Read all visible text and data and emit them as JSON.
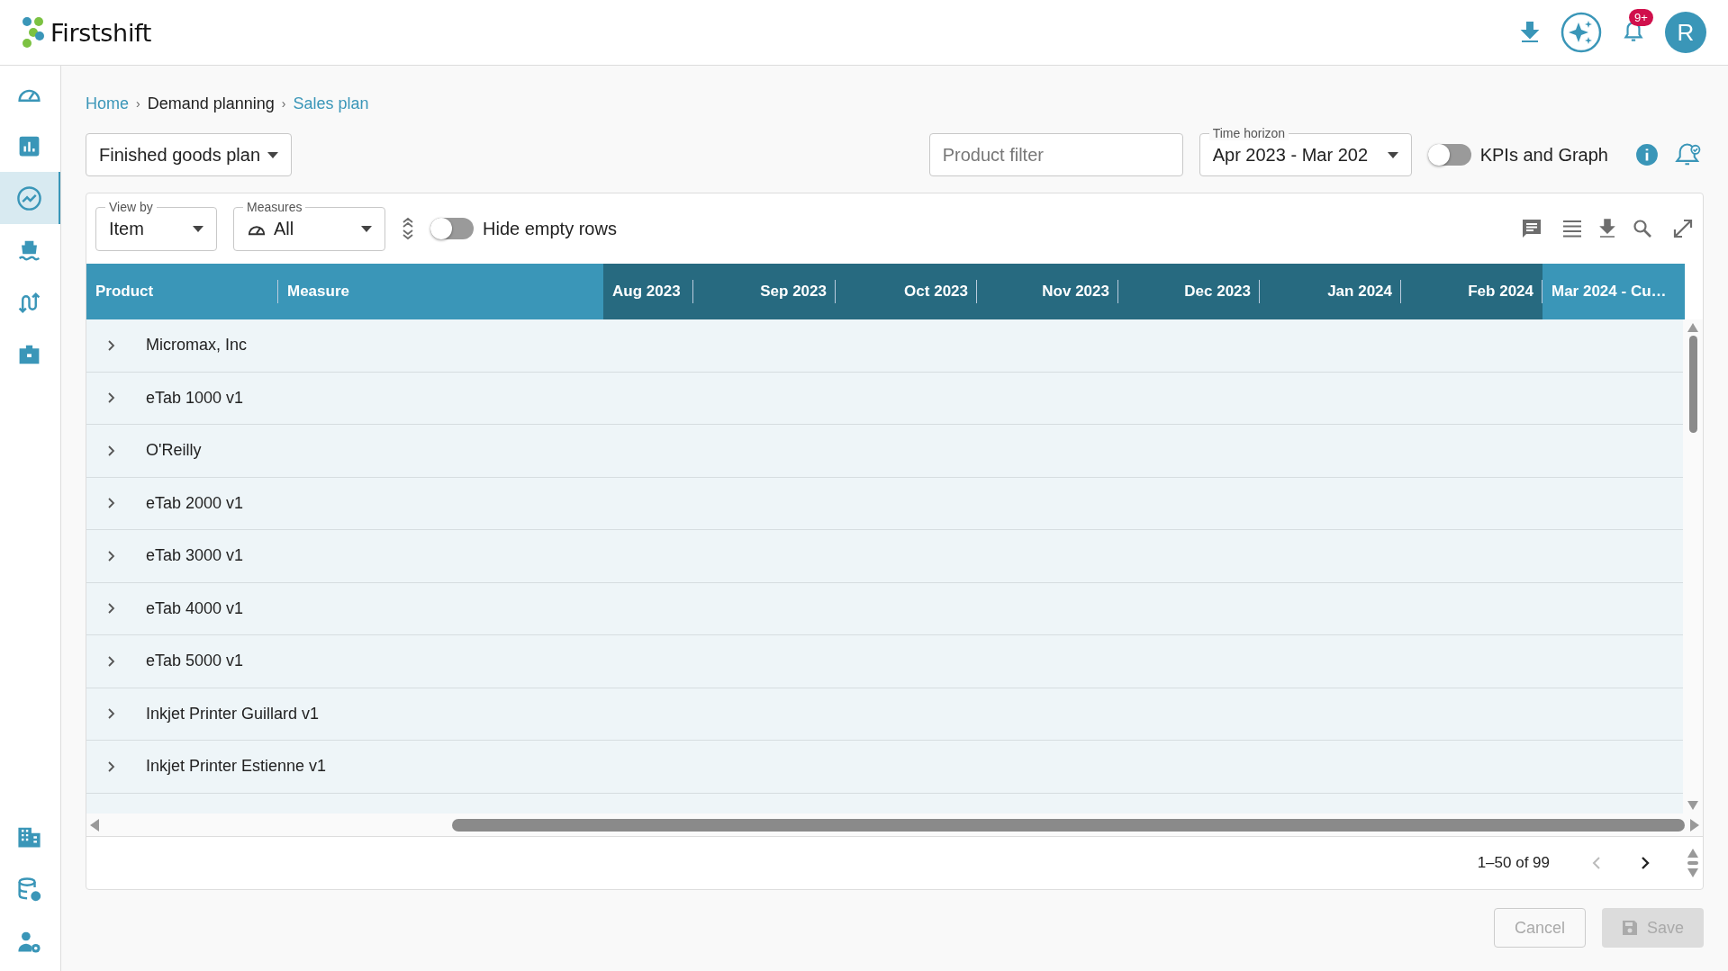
{
  "app": {
    "logo": "Firstshift",
    "notifications_badge": "9+",
    "avatar": "R"
  },
  "sidebar": {
    "items": [
      {
        "selected": false
      },
      {
        "selected": false
      },
      {
        "selected": true
      },
      {
        "selected": false
      },
      {
        "selected": false
      },
      {
        "selected": false
      }
    ],
    "bottom_items": [
      {
        "selected": false
      },
      {
        "selected": false
      },
      {
        "selected": false
      }
    ]
  },
  "breadcrumb": [
    {
      "label": "Home",
      "link": true
    },
    {
      "separator": "›",
      "label": "Demand planning",
      "link": false
    },
    {
      "separator": "›",
      "label": "Sales plan",
      "link": true
    }
  ],
  "plan_select": {
    "value": "Finished goods plan"
  },
  "product_filter": {
    "placeholder": "Product filter"
  },
  "time_horizon": {
    "label": "Time horizon",
    "value": "Apr 2023 - Mar 202"
  },
  "kpi_toggle": {
    "label": "KPIs and Graph",
    "on": false
  },
  "view_by": {
    "label": "View by",
    "value": "Item"
  },
  "measures": {
    "label": "Measures",
    "value": "All"
  },
  "hide_empty": {
    "label": "Hide empty rows",
    "on": false
  },
  "table": {
    "columns": [
      {
        "label": "Product",
        "kind": "fixed"
      },
      {
        "label": "Measure",
        "kind": "fixed"
      },
      {
        "label": "Aug 2023",
        "kind": "month"
      },
      {
        "label": "Sep 2023",
        "kind": "month"
      },
      {
        "label": "Oct 2023",
        "kind": "month"
      },
      {
        "label": "Nov 2023",
        "kind": "month"
      },
      {
        "label": "Dec 2023",
        "kind": "month"
      },
      {
        "label": "Jan 2024",
        "kind": "month"
      },
      {
        "label": "Feb 2024",
        "kind": "month"
      },
      {
        "label": "Mar 2024 - Cu…",
        "kind": "current"
      }
    ],
    "rows": [
      {
        "product": "Micromax, Inc",
        "expanded": false
      },
      {
        "product": "eTab 1000 v1",
        "expanded": false
      },
      {
        "product": "O'Reilly",
        "expanded": false
      },
      {
        "product": "eTab 2000 v1",
        "expanded": false
      },
      {
        "product": "eTab 3000 v1",
        "expanded": false
      },
      {
        "product": "eTab 4000 v1",
        "expanded": false
      },
      {
        "product": "eTab 5000 v1",
        "expanded": false
      },
      {
        "product": "Inkjet Printer Guillard v1",
        "expanded": false
      },
      {
        "product": "Inkjet Printer Estienne v1",
        "expanded": false
      }
    ]
  },
  "pagination": {
    "range": "1–50 of 99",
    "prev_disabled": true,
    "next_disabled": false
  },
  "buttons": [
    {
      "label": "Cancel",
      "kind": "outline",
      "disabled": true
    },
    {
      "label": "Save",
      "kind": "save",
      "disabled": true
    }
  ]
}
